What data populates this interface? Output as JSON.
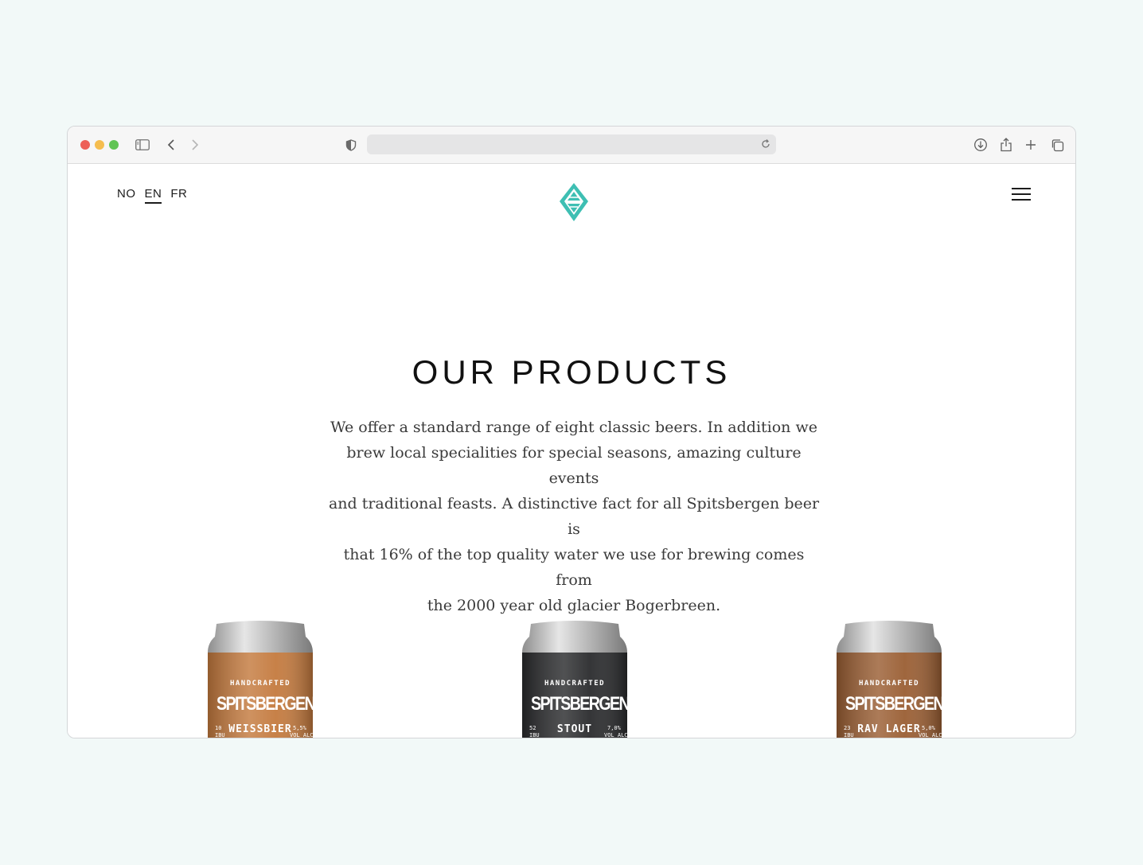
{
  "browser": {
    "address_text": ""
  },
  "nav": {
    "languages": [
      {
        "label": "NO",
        "active": false
      },
      {
        "label": "EN",
        "active": true
      },
      {
        "label": "FR",
        "active": false
      }
    ],
    "logo_icon": "diamond-mountain-logo-icon",
    "menu_icon": "hamburger-menu-icon"
  },
  "content": {
    "title": "OUR PRODUCTS",
    "intro_lines": [
      "We offer a standard range of eight classic beers. In addition we",
      "brew local specialities for special seasons, amazing culture events",
      "and traditional feasts. A distinctive fact for all Spitsbergen beer is",
      "that 16% of the top quality water we use for brewing comes from",
      "the 2000 year old glacier Bogerbreen."
    ]
  },
  "products": [
    {
      "tag": "HANDCRAFTED",
      "brand": "SPITSBERGEN",
      "name": "WEISSBIER",
      "ibu_value": "10",
      "ibu_unit": "IBU",
      "abv_value": "5,5%",
      "abv_unit": "VOL ALC",
      "color": "#c47a3e"
    },
    {
      "tag": "HANDCRAFTED",
      "brand": "SPITSBERGEN",
      "name": "STOUT",
      "ibu_value": "52",
      "ibu_unit": "IBU",
      "abv_value": "7,0%",
      "abv_unit": "VOL ALC",
      "color": "#2a2b2d"
    },
    {
      "tag": "HANDCRAFTED",
      "brand": "SPITSBERGEN",
      "name": "RAV LAGER",
      "ibu_value": "23",
      "ibu_unit": "IBU",
      "abv_value": "5,0%",
      "abv_unit": "VOL ALC",
      "color": "#9a5e33"
    }
  ],
  "colors": {
    "accent": "#3ebfb3",
    "background": "#f2f9f8"
  }
}
